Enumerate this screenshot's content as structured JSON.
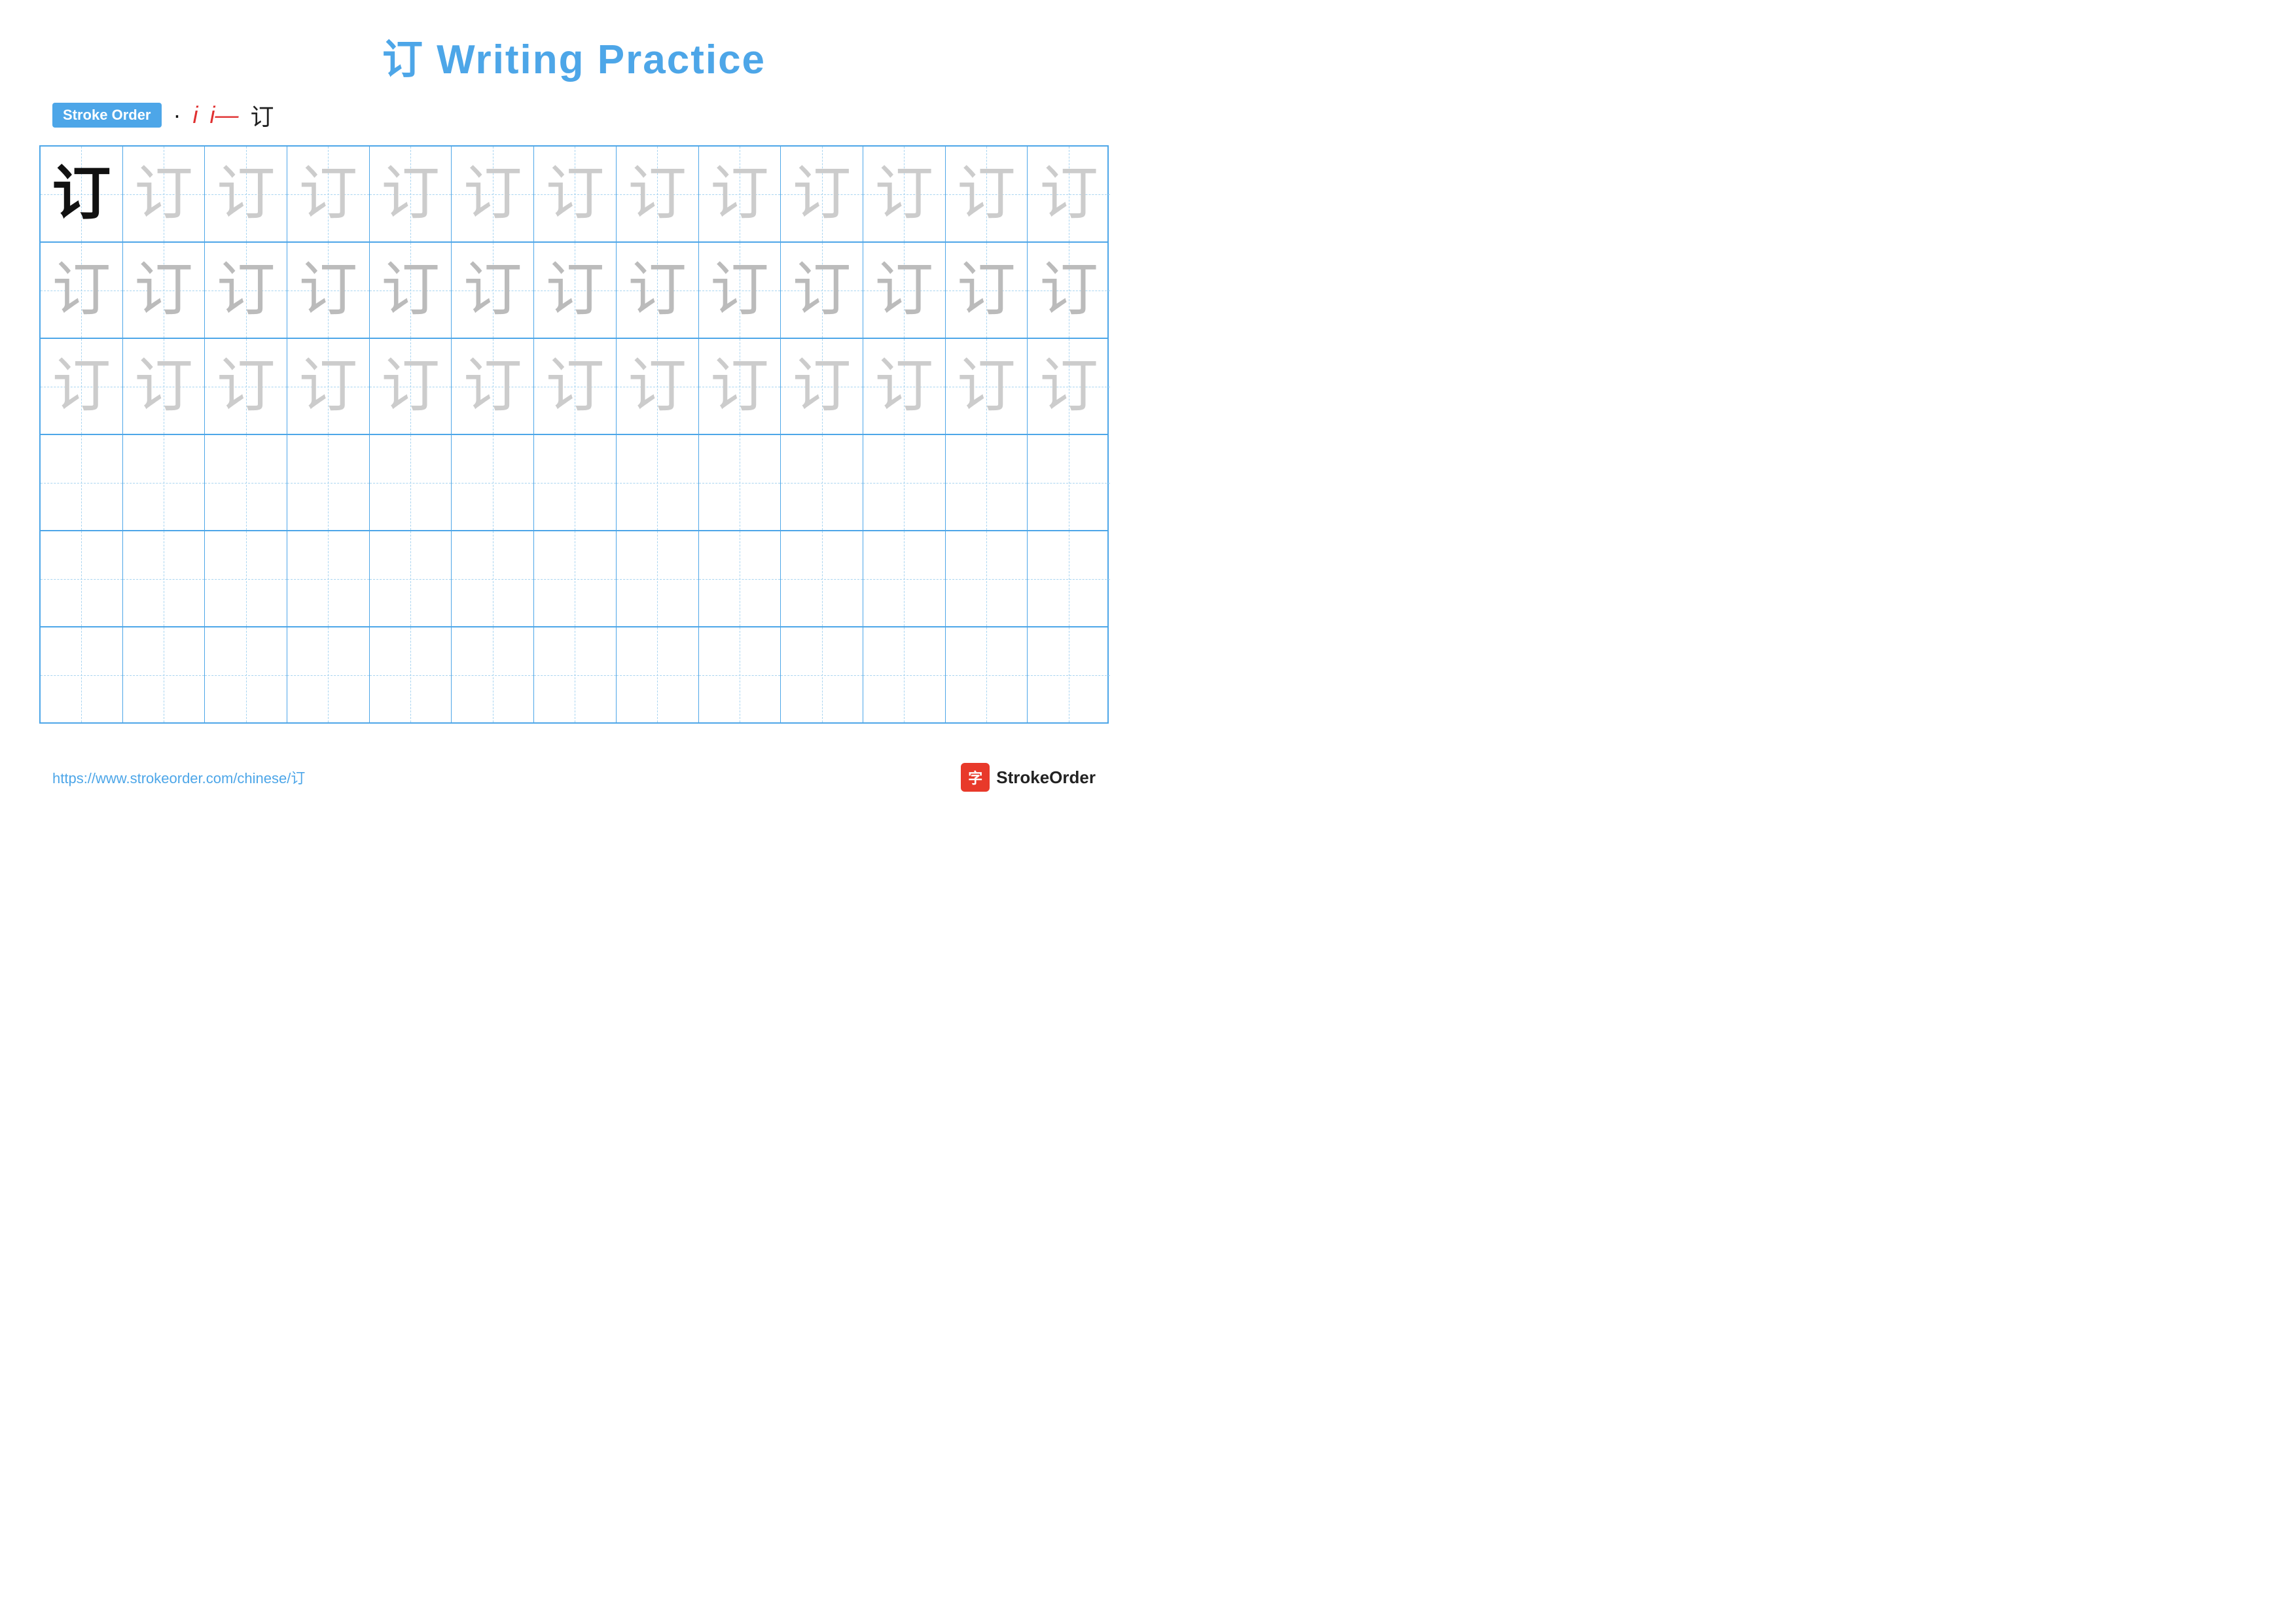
{
  "header": {
    "title": "订 Writing Practice"
  },
  "stroke_order": {
    "badge_label": "Stroke Order",
    "steps": [
      "·",
      "i",
      "i—",
      "订"
    ]
  },
  "grid": {
    "rows": 6,
    "cols": 13,
    "char": "订",
    "row_styles": [
      "dark_first",
      "medium_all",
      "light_all",
      "empty",
      "empty",
      "empty"
    ]
  },
  "footer": {
    "url": "https://www.strokeorder.com/chinese/订",
    "logo_icon": "字",
    "logo_text": "StrokeOrder"
  }
}
